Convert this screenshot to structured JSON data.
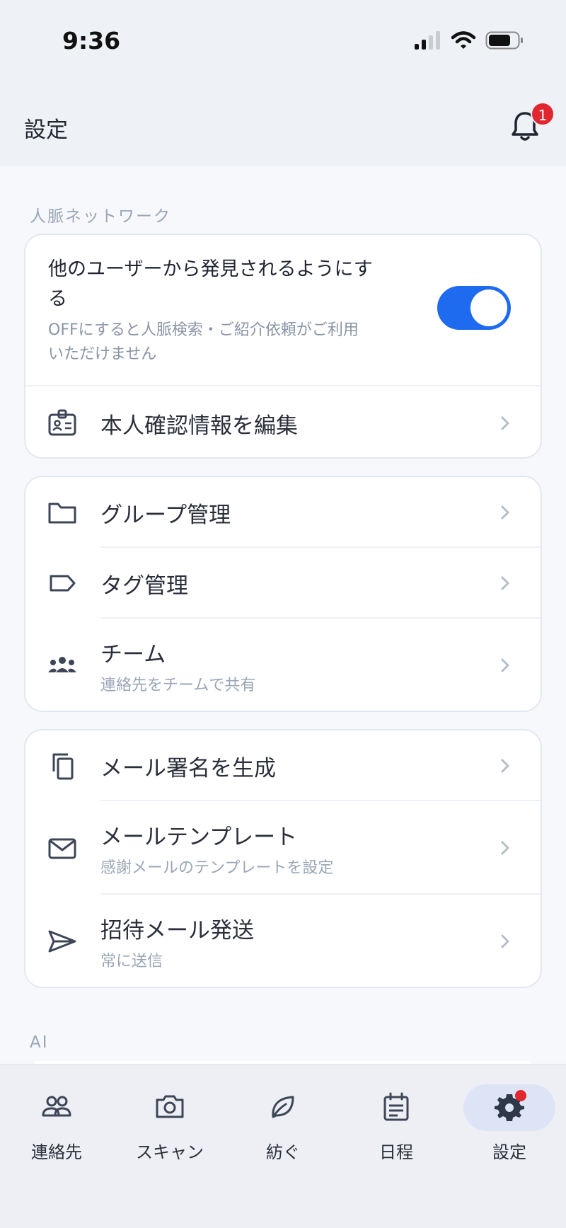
{
  "status": {
    "time": "9:36"
  },
  "header": {
    "title": "設定",
    "notification_count": "1"
  },
  "sections": {
    "network_label": "人脈ネットワーク",
    "ai_label": "AI"
  },
  "network": {
    "discover_title": "他のユーザーから発見されるようにする",
    "discover_title_line1": "他のユーザーから発見されるようにす",
    "discover_title_line2": "る",
    "discover_desc_line1": "OFFにすると人脈検索・ご紹介依頼がご利用",
    "discover_desc_line2": "いただけません",
    "discover_enabled": true,
    "edit_identity": "本人確認情報を編集"
  },
  "manage": {
    "group": "グループ管理",
    "tag": "タグ管理",
    "team": "チーム",
    "team_sub": "連絡先をチームで共有"
  },
  "mail": {
    "signature": "メール署名を生成",
    "template": "メールテンプレート",
    "template_sub": "感謝メールのテンプレートを設定",
    "invite": "招待メール発送",
    "invite_sub": "常に送信"
  },
  "tabs": [
    {
      "label": "連絡先",
      "icon": "contacts-icon"
    },
    {
      "label": "スキャン",
      "icon": "camera-icon"
    },
    {
      "label": "紡ぐ",
      "icon": "leaf-icon"
    },
    {
      "label": "日程",
      "icon": "calendar-icon"
    },
    {
      "label": "設定",
      "icon": "gear-icon",
      "active": true
    }
  ],
  "colors": {
    "accent": "#1f6bf0",
    "badge": "#e0262f"
  }
}
